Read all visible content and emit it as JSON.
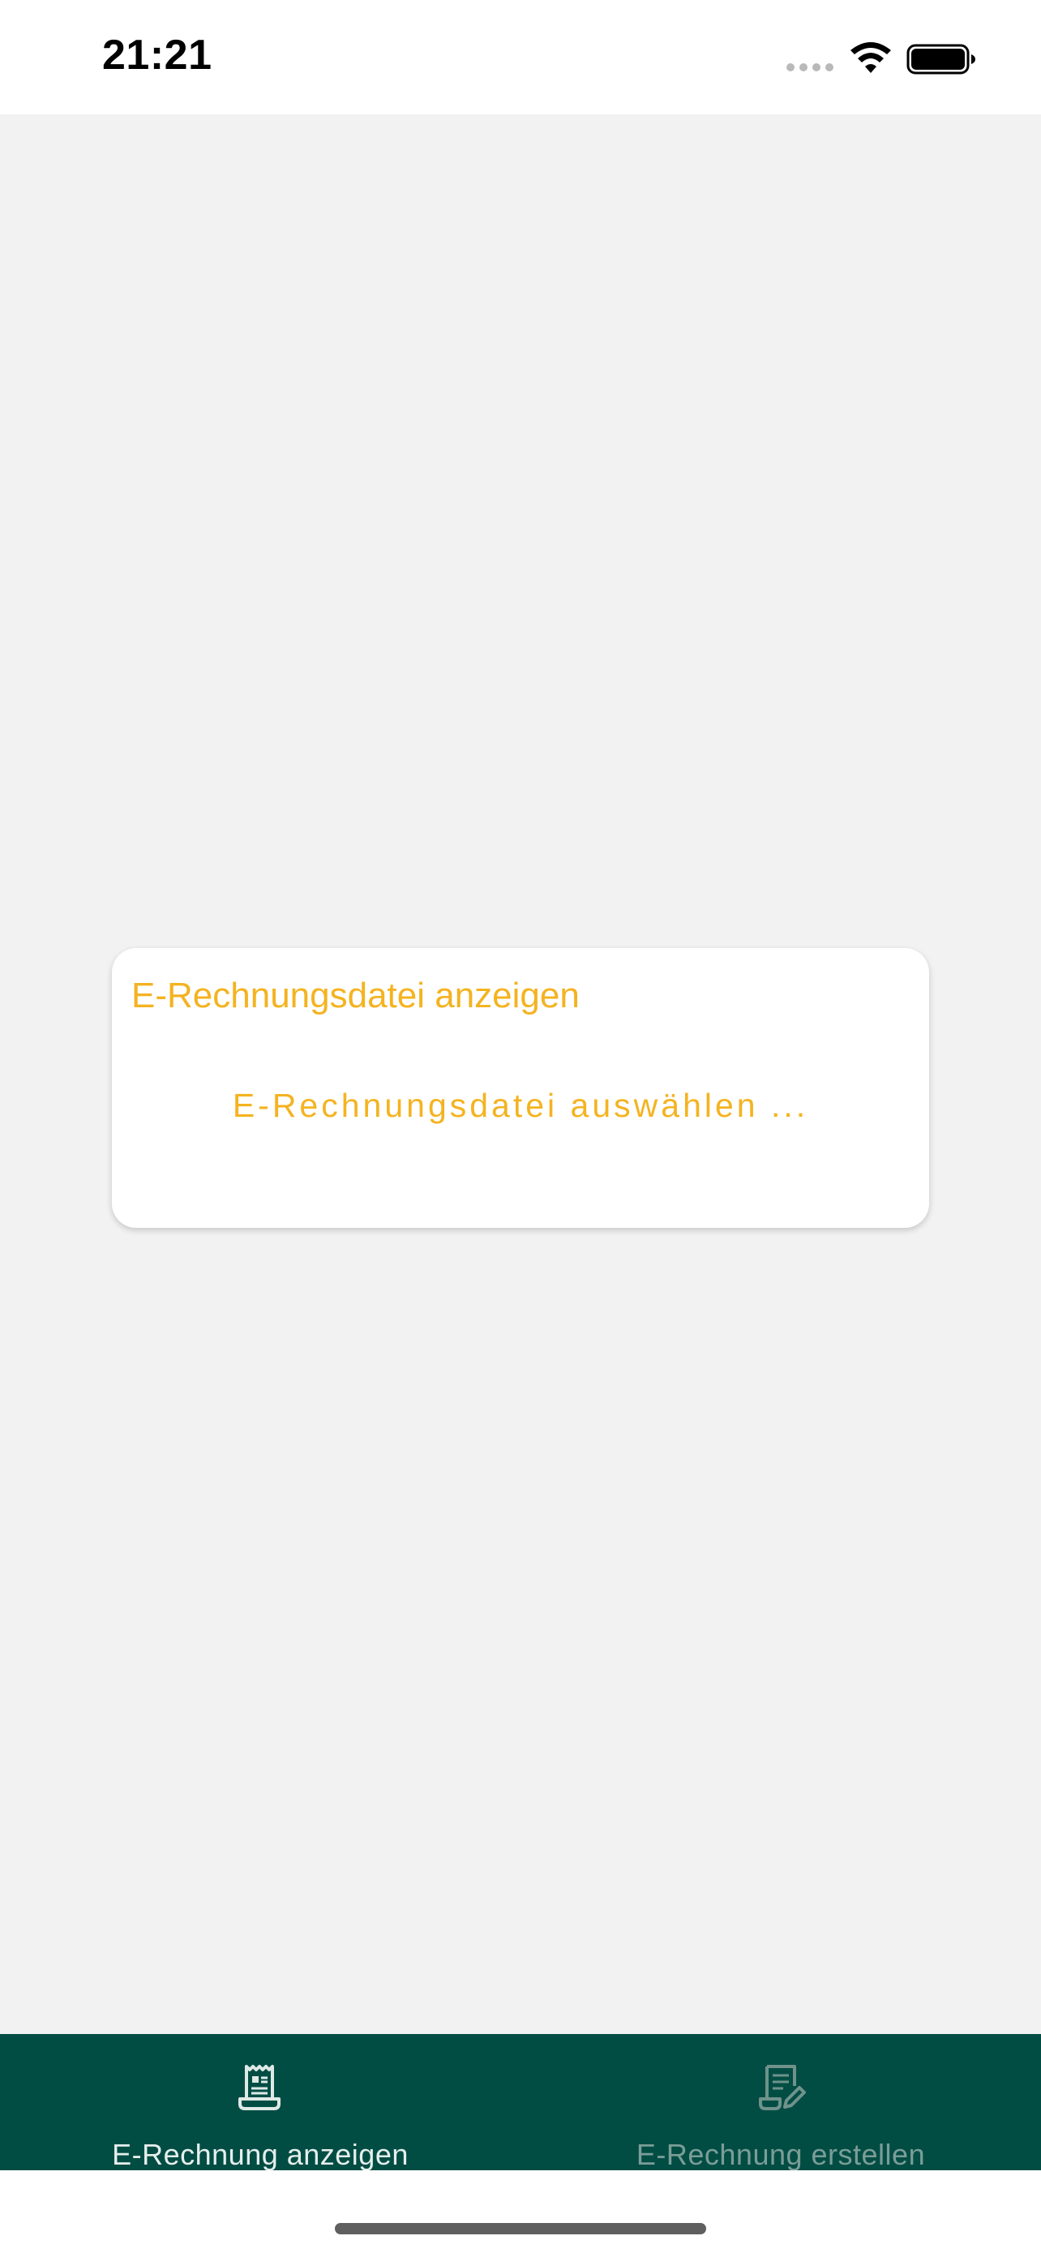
{
  "status_bar": {
    "time": "21:21"
  },
  "card": {
    "title": "E-Rechnungsdatei anzeigen",
    "select_button_label": "E-Rechnungsdatei auswählen ..."
  },
  "bottom_nav": {
    "items": [
      {
        "label": "E-Rechnung anzeigen",
        "icon": "receipt-icon",
        "active": true
      },
      {
        "label": "E-Rechnung erstellen",
        "icon": "edit-document-icon",
        "active": false
      }
    ]
  },
  "colors": {
    "accent": "#f4b320",
    "nav_background": "#014d44",
    "background": "#f2f2f2"
  }
}
